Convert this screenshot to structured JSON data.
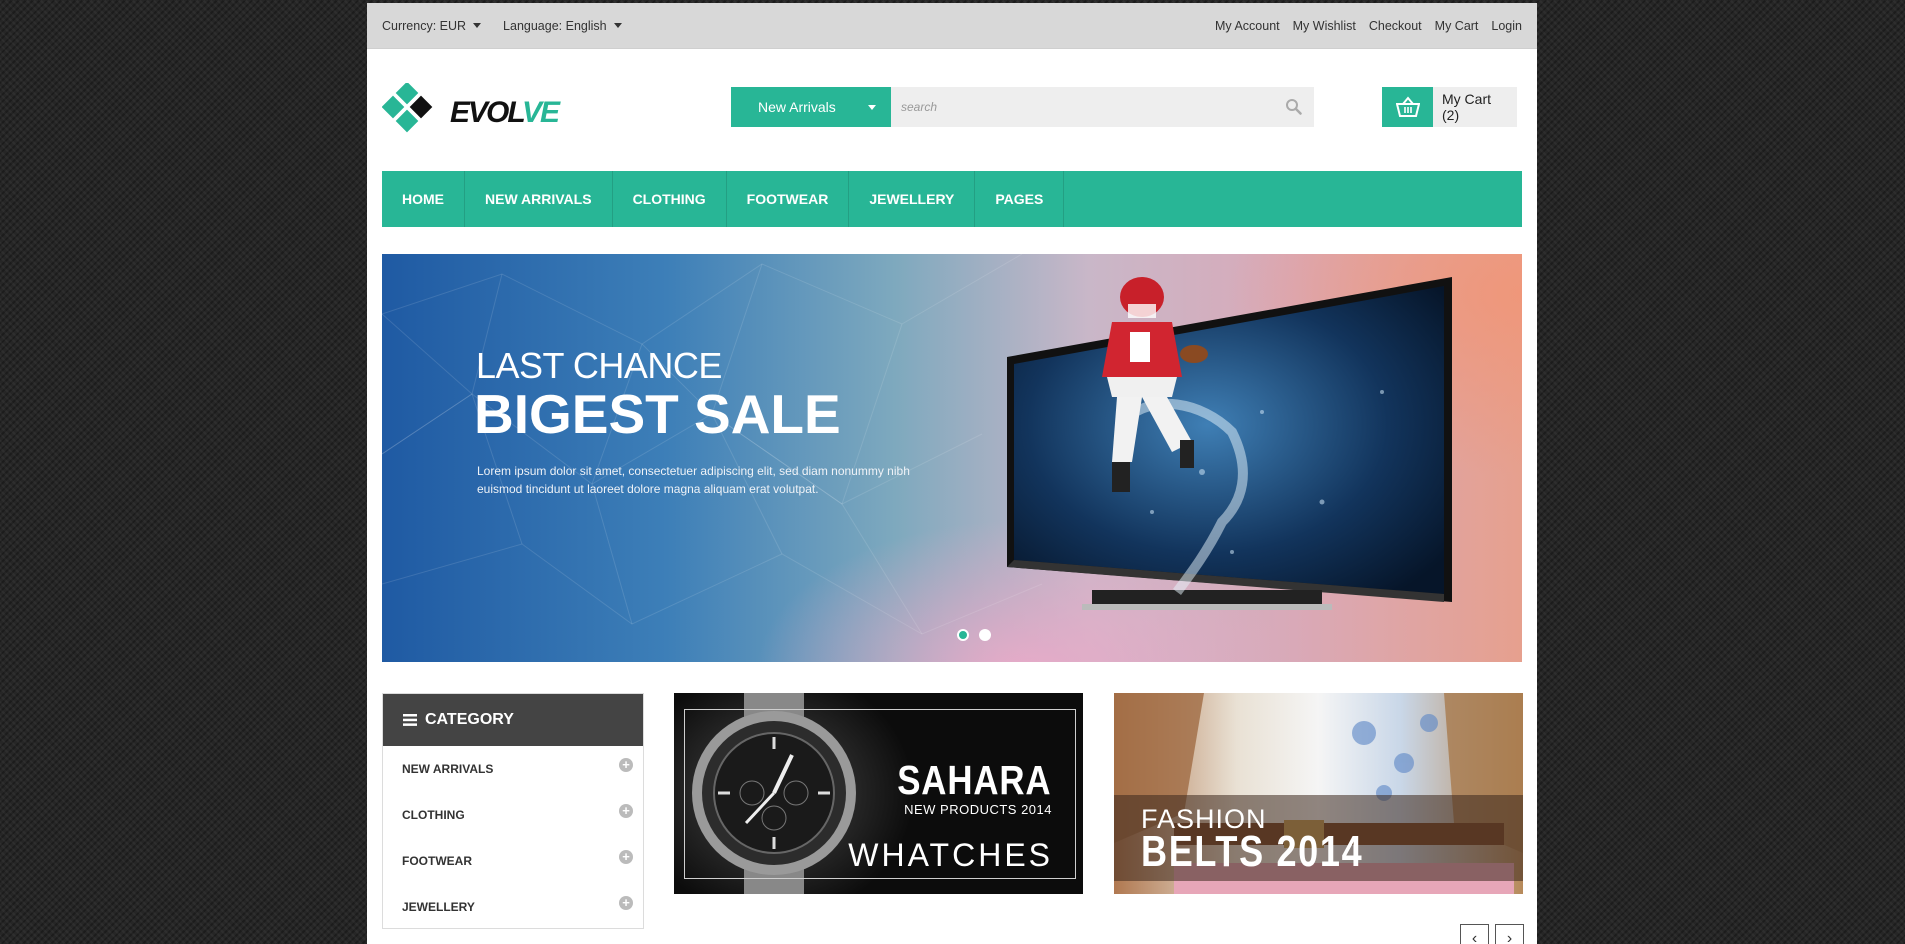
{
  "topbar": {
    "currency_label": "Currency: EUR",
    "language_label": "Language: English",
    "links": [
      "My Account",
      "My Wishlist",
      "Checkout",
      "My Cart",
      "Login"
    ]
  },
  "header": {
    "logo_part1": "EVOL",
    "logo_part2": "VE",
    "search_category": "New Arrivals",
    "search_placeholder": "search",
    "cart_label": "My Cart (2)"
  },
  "nav": {
    "items": [
      "HOME",
      "NEW ARRIVALS",
      "CLOTHING",
      "FOOTWEAR",
      "JEWELLERY",
      "PAGES"
    ]
  },
  "banner": {
    "line1": "LAST CHANCE",
    "line2": "BIGEST SALE",
    "text": "Lorem ipsum dolor sit amet, consectetuer adipiscing elit, sed diam nonummy nibh euismod tincidunt ut laoreet dolore magna aliquam erat volutpat.",
    "slides": 2,
    "active_slide": 1
  },
  "category": {
    "title": "CATEGORY",
    "items": [
      "NEW ARRIVALS",
      "CLOTHING",
      "FOOTWEAR",
      "JEWELLERY"
    ]
  },
  "promos": {
    "watches": {
      "title": "SAHARA",
      "subtitle": "NEW PRODUCTS 2014",
      "caption": "WHATCHES"
    },
    "belts": {
      "line1": "FASHION",
      "line2": "BELTS 2014"
    }
  },
  "carousel": {
    "prev": "‹",
    "next": "›"
  },
  "colors": {
    "accent": "#28b696",
    "dark": "#444444",
    "topbar": "#d8d8d8"
  }
}
